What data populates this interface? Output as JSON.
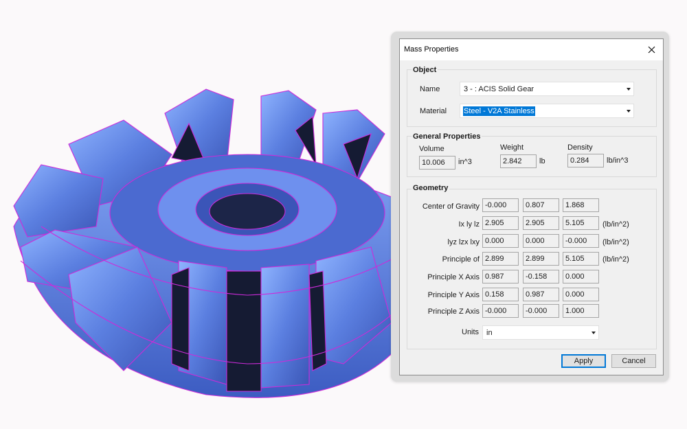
{
  "dialog": {
    "title": "Mass Properties",
    "close_icon": "close-icon"
  },
  "object_group": {
    "title": "Object",
    "name_label": "Name",
    "name_value": "3 - : ACIS Solid Gear",
    "material_label": "Material",
    "material_value": "Steel - V2A Stainless"
  },
  "general": {
    "title": "General Properties",
    "volume_label": "Volume",
    "volume_value": "10.006",
    "volume_unit": "in^3",
    "weight_label": "Weight",
    "weight_value": "2.842",
    "weight_unit": "lb",
    "density_label": "Density",
    "density_value": "0.284",
    "density_unit": "lb/in^3"
  },
  "geometry": {
    "title": "Geometry",
    "rows": [
      {
        "label": "Center of Gravity",
        "values": [
          "-0.000",
          "0.807",
          "1.868"
        ],
        "unit": ""
      },
      {
        "label": "Ix ly lz",
        "values": [
          "2.905",
          "2.905",
          "5.105"
        ],
        "unit": "(lb/in^2)"
      },
      {
        "label": "lyz lzx lxy",
        "values": [
          "0.000",
          "0.000",
          "-0.000"
        ],
        "unit": "(lb/in^2)"
      },
      {
        "label": "Principle of",
        "values": [
          "2.899",
          "2.899",
          "5.105"
        ],
        "unit": "(lb/in^2)"
      },
      {
        "label": "Principle X Axis",
        "values": [
          "0.987",
          "-0.158",
          "0.000"
        ],
        "unit": ""
      },
      {
        "label": "Principle Y Axis",
        "values": [
          "0.158",
          "0.987",
          "0.000"
        ],
        "unit": ""
      },
      {
        "label": "Principle Z Axis",
        "values": [
          "-0.000",
          "-0.000",
          "1.000"
        ],
        "unit": ""
      }
    ],
    "units_label": "Units",
    "units_value": "in"
  },
  "buttons": {
    "apply": "Apply",
    "cancel": "Cancel"
  },
  "colors": {
    "gear_fill": "#5b7fe0",
    "gear_shadow": "#151b33",
    "wireframe": "#cc2bd9",
    "selection": "#0078d7"
  }
}
